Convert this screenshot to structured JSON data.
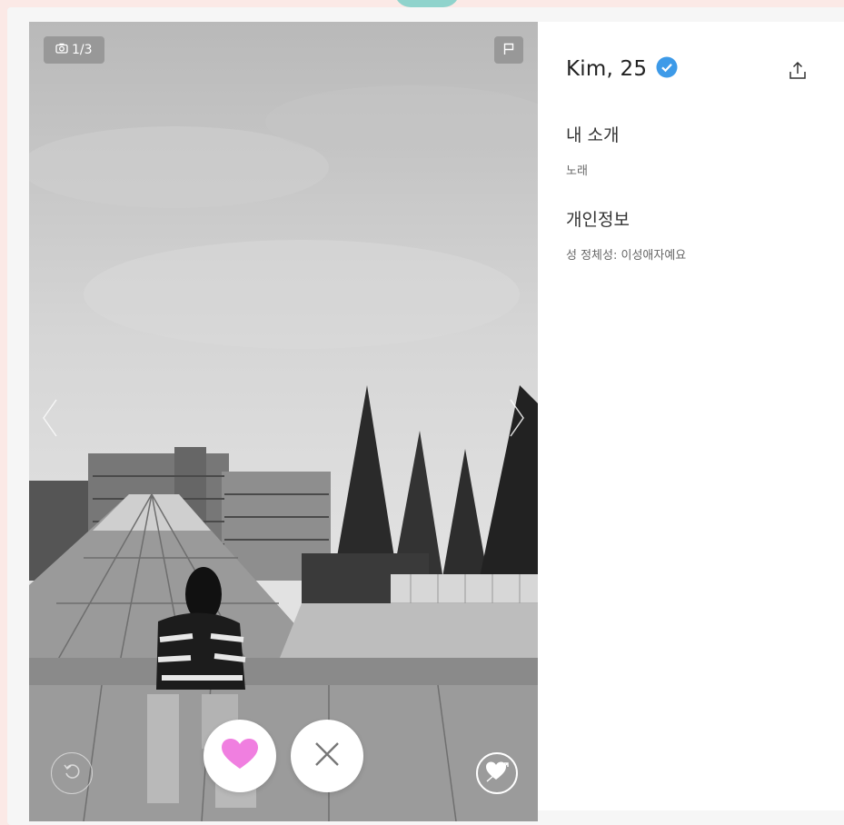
{
  "photo": {
    "counter": "1/3",
    "counter_icon": "camera-icon",
    "flag_icon": "flag-icon",
    "prev_icon": "chevron-left-icon",
    "next_icon": "chevron-right-icon"
  },
  "actions": {
    "undo_icon": "undo-icon",
    "like_icon": "heart-icon",
    "like_color": "#f07fe0",
    "pass_icon": "close-icon",
    "pass_color": "#777777",
    "superlike_icon": "heart-arrow-icon"
  },
  "profile": {
    "name_age": "Kim, 25",
    "verified_color": "#3d9ae8",
    "share_icon": "share-icon",
    "about_title": "내 소개",
    "about_text": "노래",
    "info_title": "개인정보",
    "info_text": "성 정체성: 이성애자예요"
  },
  "colors": {
    "page_bg": "#fbe9e6",
    "accent_tab": "#8fd3cc"
  }
}
